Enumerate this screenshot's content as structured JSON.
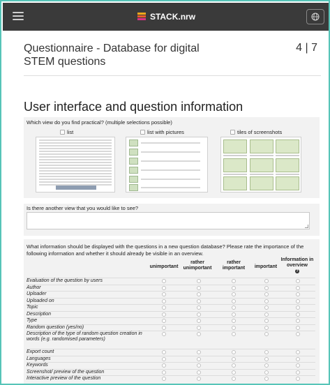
{
  "brand": "STACK.nrw",
  "survey_title": "Questionnaire - Database for digital STEM questions",
  "page_counter": "4 | 7",
  "section_title": "User interface and question information",
  "q1": {
    "text": "Which view do you find practical? (multiple selections possible)",
    "options": [
      "list",
      "list with pictures",
      "tiles of screenshots"
    ]
  },
  "q2": {
    "text": "Is there another view that you would like to see?"
  },
  "q3": {
    "text": "What information should be displayed with the questions in a new question database? Please rate the importance of the following information and whether it should already be visible in an overview.",
    "columns": [
      "unimportant",
      "rather unimportant",
      "rather important",
      "important",
      "Information in overview"
    ],
    "rows": [
      "Evaluation of the question by users",
      "Author",
      "Uploader",
      "Uploaded on",
      "Topic",
      "Description",
      "Type",
      "Random question (yes/no)",
      "Description of the type of random question creation in words (e.g. randomised parameters)",
      "Export count",
      "Languages",
      "Keywords",
      "Screenshot/ preview of the question",
      "Interactive preview of the question"
    ]
  },
  "colors": {
    "topbar": "#3a3a3a",
    "frame": "#57c4b8",
    "panel": "#f2f2f2"
  }
}
